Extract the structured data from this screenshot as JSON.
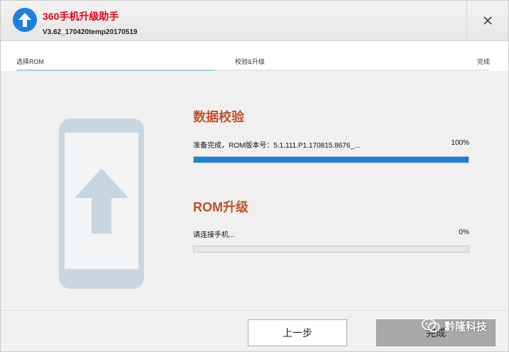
{
  "app": {
    "title": "360手机升级助手",
    "version": "V3.62_170420temp20170519",
    "logo_icon": "upload-arrow-icon",
    "accent": "#1a7fe0"
  },
  "window": {
    "close_icon": "close-icon"
  },
  "steps": {
    "items": [
      "选择ROM",
      "校验&升级",
      "完成"
    ]
  },
  "sections": {
    "verify": {
      "title": "数据校验",
      "status": "准备完成，ROM版本号：5.1.111.P1.170815.8676_...",
      "percent_label": "100%",
      "progress": 100
    },
    "upgrade": {
      "title": "ROM升级",
      "status": "请连接手机...",
      "percent_label": "0%",
      "progress": 0
    }
  },
  "footer": {
    "back_label": "上一步",
    "finish_label": "完成"
  },
  "watermark": {
    "text": "黔隆科技"
  }
}
